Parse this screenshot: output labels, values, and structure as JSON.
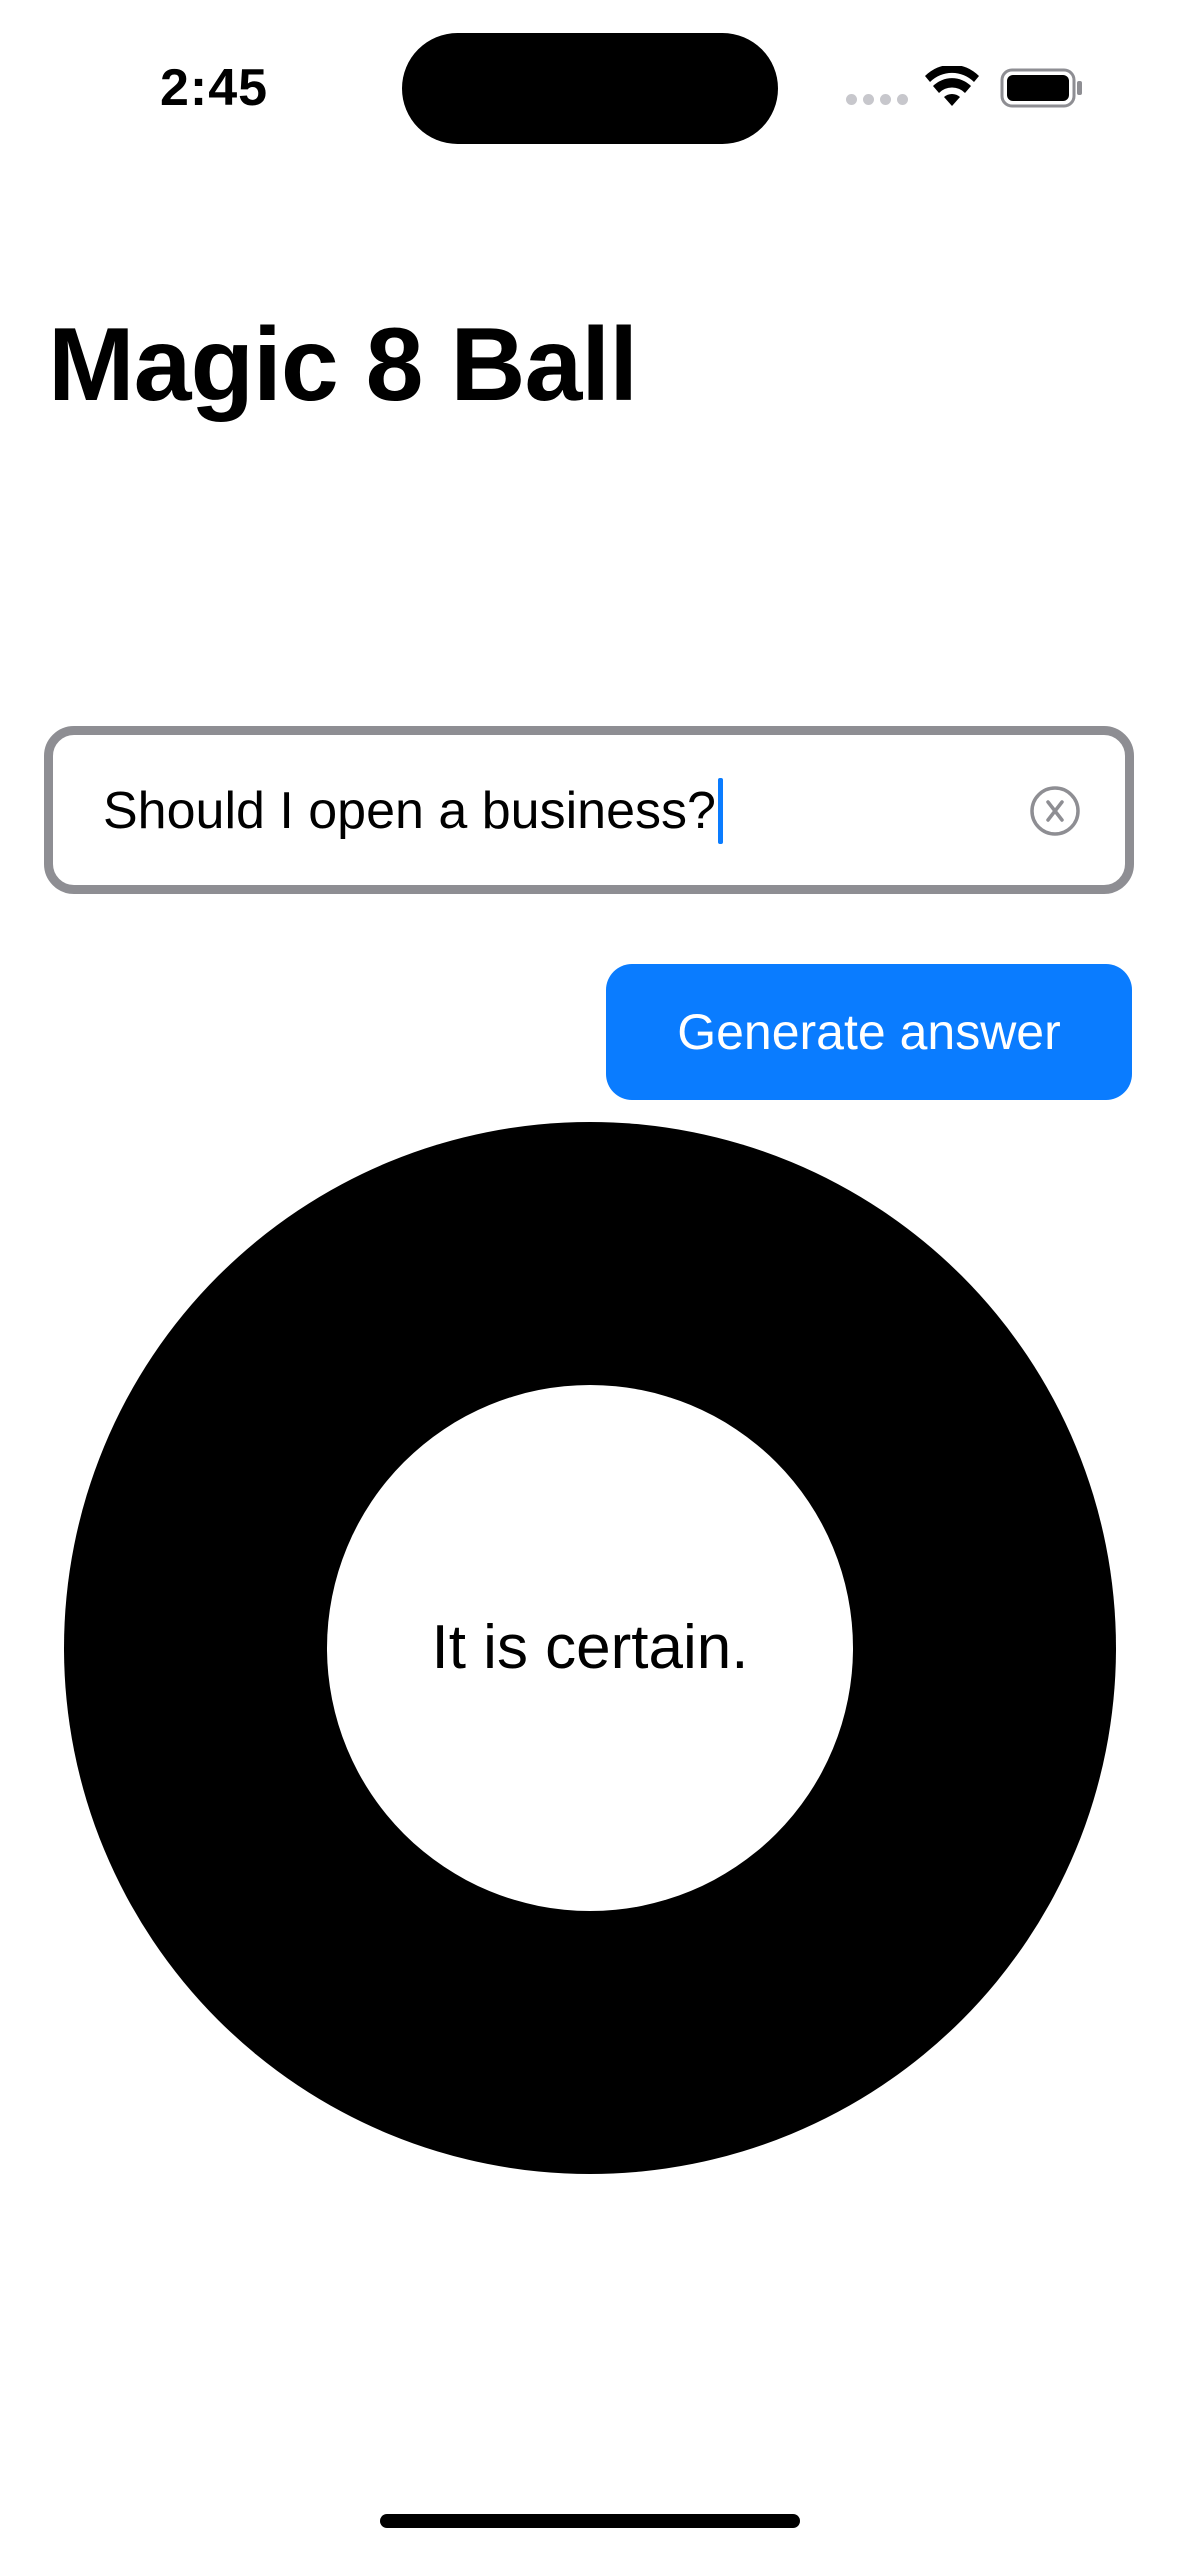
{
  "status_bar": {
    "time": "2:45",
    "icons": [
      "signal-dots-icon",
      "wifi-icon",
      "battery-icon"
    ]
  },
  "header": {
    "title": "Magic 8 Ball"
  },
  "question_field": {
    "value": "Should I open a business?",
    "clear_icon": "clear-x-icon"
  },
  "actions": {
    "generate_label": "Generate answer"
  },
  "ball": {
    "answer": "It is certain."
  },
  "colors": {
    "accent": "#0a7cff",
    "field_border": "#8e8e93",
    "ball": "#000000",
    "background": "#ffffff"
  }
}
